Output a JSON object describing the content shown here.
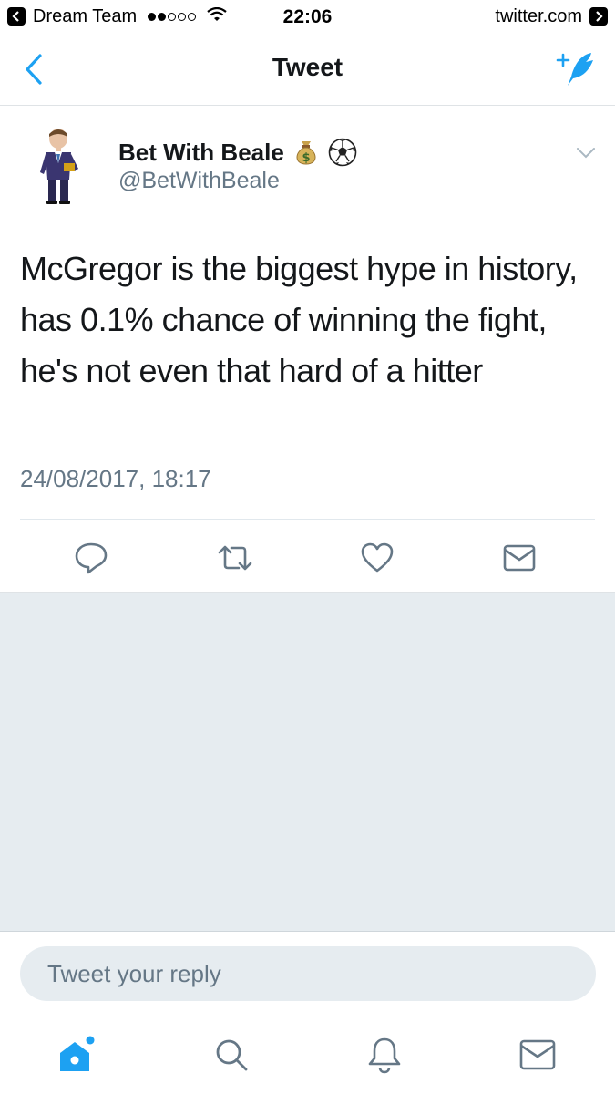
{
  "status_bar": {
    "carrier": "Dream Team",
    "time": "22:06",
    "domain": "twitter.com",
    "signal_bars_filled": 2,
    "signal_bars_total": 5
  },
  "nav": {
    "title": "Tweet",
    "back_icon": "chevron-left-icon",
    "compose_icon": "compose-tweet-icon"
  },
  "tweet": {
    "author_name": "Bet With Beale",
    "author_emojis": [
      "money-bag-icon",
      "soccer-ball-icon"
    ],
    "handle": "@BetWithBeale",
    "text": "McGregor is the biggest hype in history, has 0.1% chance of winning the fight, he's not even that hard of a hitter",
    "timestamp": "24/08/2017, 18:17",
    "actions": [
      "reply-icon",
      "retweet-icon",
      "like-icon",
      "direct-message-icon"
    ]
  },
  "reply": {
    "placeholder": "Tweet your reply"
  },
  "tabs": [
    {
      "name": "home",
      "icon": "home-icon",
      "active": true
    },
    {
      "name": "search",
      "icon": "search-icon",
      "active": false
    },
    {
      "name": "notifications",
      "icon": "bell-icon",
      "active": false
    },
    {
      "name": "messages",
      "icon": "envelope-icon",
      "active": false
    }
  ],
  "colors": {
    "accent": "#1da1f2",
    "icon_gray": "#657786",
    "text": "#14171a",
    "background_gray": "#e6ecf0"
  }
}
